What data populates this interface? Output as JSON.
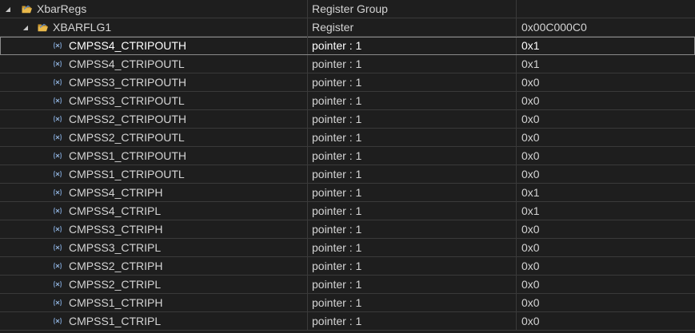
{
  "root": {
    "name": "XbarRegs",
    "type": "Register Group",
    "value": ""
  },
  "register": {
    "name": "XBARFLG1",
    "type": "Register",
    "value": "0x00C000C0"
  },
  "fields": [
    {
      "name": "CMPSS4_CTRIPOUTH",
      "type": "pointer : 1",
      "value": "0x1",
      "selected": true
    },
    {
      "name": "CMPSS4_CTRIPOUTL",
      "type": "pointer : 1",
      "value": "0x1"
    },
    {
      "name": "CMPSS3_CTRIPOUTH",
      "type": "pointer : 1",
      "value": "0x0"
    },
    {
      "name": "CMPSS3_CTRIPOUTL",
      "type": "pointer : 1",
      "value": "0x0"
    },
    {
      "name": "CMPSS2_CTRIPOUTH",
      "type": "pointer : 1",
      "value": "0x0"
    },
    {
      "name": "CMPSS2_CTRIPOUTL",
      "type": "pointer : 1",
      "value": "0x0"
    },
    {
      "name": "CMPSS1_CTRIPOUTH",
      "type": "pointer : 1",
      "value": "0x0"
    },
    {
      "name": "CMPSS1_CTRIPOUTL",
      "type": "pointer : 1",
      "value": "0x0"
    },
    {
      "name": "CMPSS4_CTRIPH",
      "type": "pointer : 1",
      "value": "0x1"
    },
    {
      "name": "CMPSS4_CTRIPL",
      "type": "pointer : 1",
      "value": "0x1"
    },
    {
      "name": "CMPSS3_CTRIPH",
      "type": "pointer : 1",
      "value": "0x0"
    },
    {
      "name": "CMPSS3_CTRIPL",
      "type": "pointer : 1",
      "value": "0x0"
    },
    {
      "name": "CMPSS2_CTRIPH",
      "type": "pointer : 1",
      "value": "0x0"
    },
    {
      "name": "CMPSS2_CTRIPL",
      "type": "pointer : 1",
      "value": "0x0"
    },
    {
      "name": "CMPSS1_CTRIPH",
      "type": "pointer : 1",
      "value": "0x0"
    },
    {
      "name": "CMPSS1_CTRIPL",
      "type": "pointer : 1",
      "value": "0x0"
    }
  ],
  "icons": {
    "expander": "expanded-triangle-icon",
    "group": "folder-open-icon",
    "field": "bitfield-icon"
  },
  "colors": {
    "background": "#1e1e1e",
    "grid": "#3a3a3a",
    "text": "#d4d4d4",
    "folder": "#e8b84a",
    "field_icon": "#6f8fb8",
    "selection_outline": "#8a8a8a"
  }
}
